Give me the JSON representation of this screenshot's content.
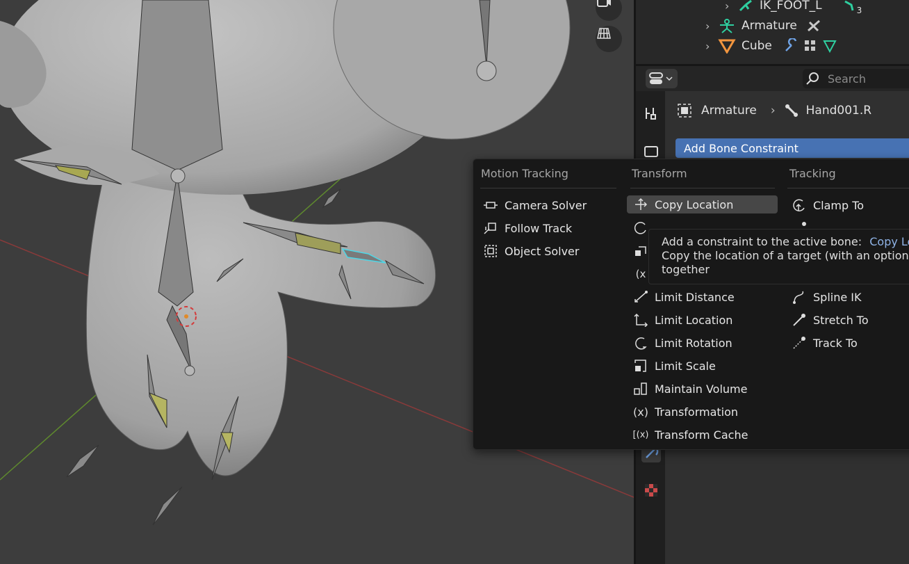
{
  "outliner": {
    "rows": [
      {
        "label": "IK_FOOT_L",
        "badge": "3"
      },
      {
        "label": "Armature"
      },
      {
        "label": "Cube"
      }
    ]
  },
  "properties": {
    "search_placeholder": "Search",
    "breadcrumb": {
      "object": "Armature",
      "bone": "Hand001.R"
    },
    "add_constraint_label": "Add Bone Constraint"
  },
  "menu": {
    "columns": [
      {
        "title": "Motion Tracking",
        "items": [
          "Camera Solver",
          "Follow Track",
          "Object Solver"
        ]
      },
      {
        "title": "Transform",
        "items": [
          "Copy Location",
          "Limit Distance",
          "Limit Location",
          "Limit Rotation",
          "Limit Scale",
          "Maintain Volume",
          "Transformation",
          "Transform Cache"
        ]
      },
      {
        "title": "Tracking",
        "items": [
          "Clamp To",
          "Spline IK",
          "Stretch To",
          "Track To"
        ]
      }
    ]
  },
  "tooltip": {
    "line1": "Add a constraint to the active bone:",
    "line1_highlight": "Copy Loc",
    "line2": "Copy the location of a target (with an optiona",
    "line3": "together"
  },
  "colors": {
    "accent": "#4772b3",
    "menu_bg": "#181818",
    "highlight": "#474747"
  }
}
